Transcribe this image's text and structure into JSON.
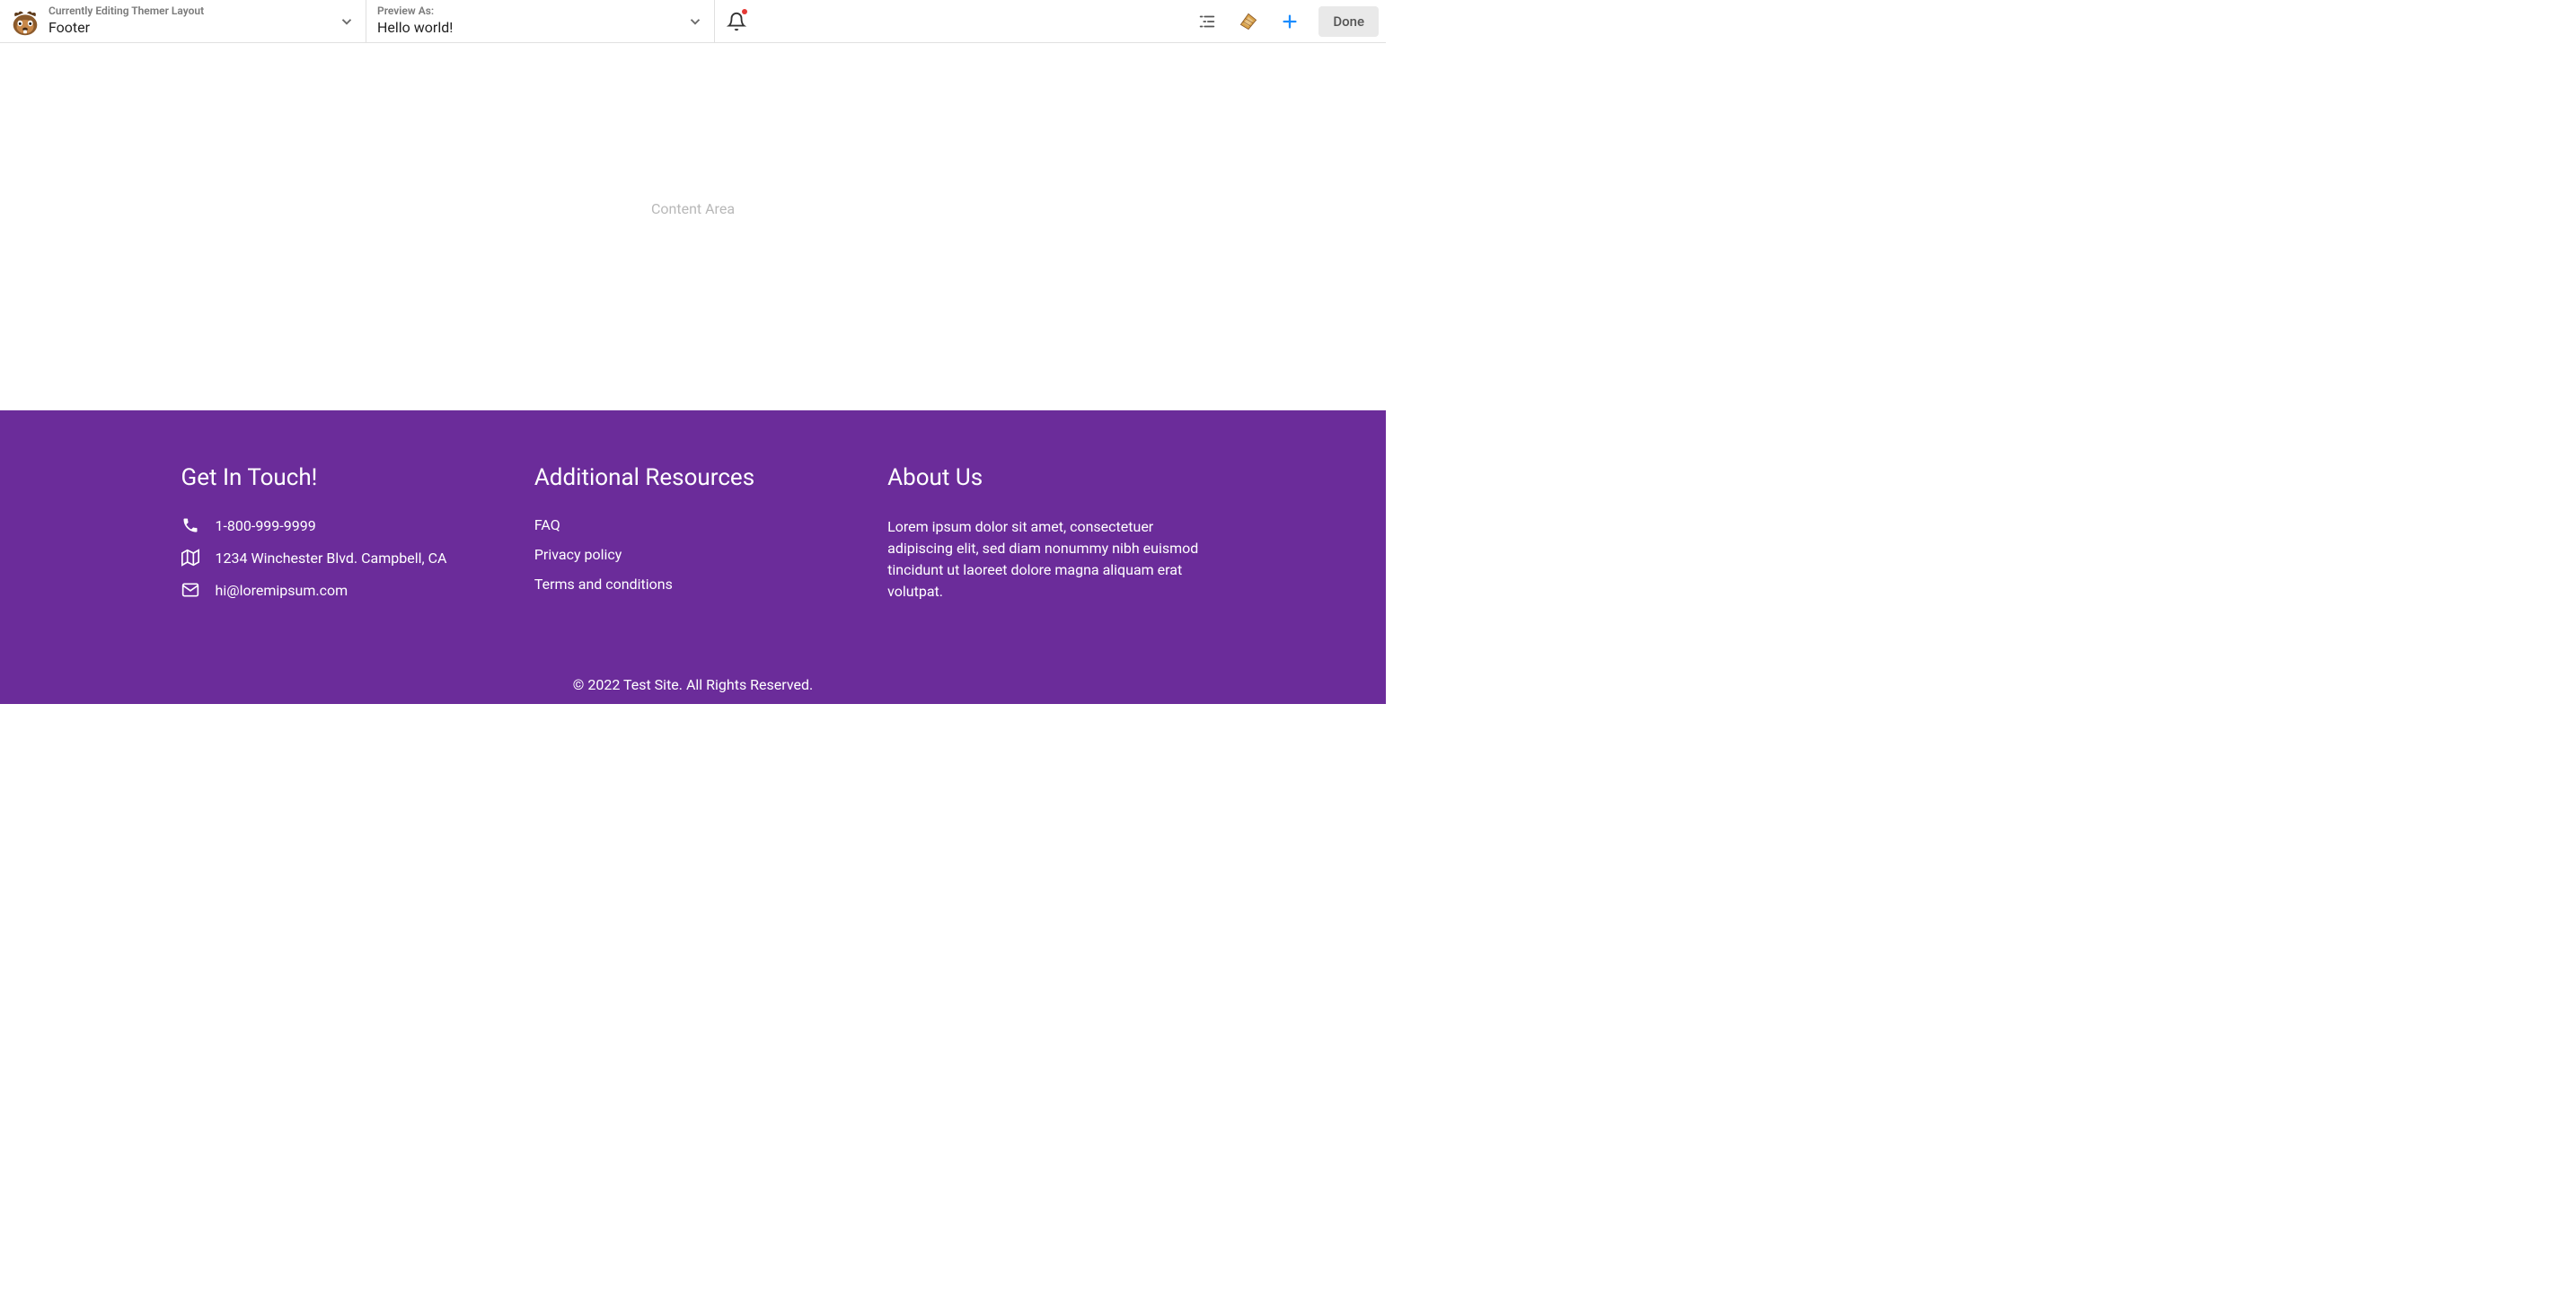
{
  "topbar": {
    "editing": {
      "sublabel": "Currently Editing Themer Layout",
      "title": "Footer"
    },
    "preview": {
      "sublabel": "Preview As:",
      "title": "Hello world!"
    },
    "done_label": "Done"
  },
  "content": {
    "placeholder": "Content Area"
  },
  "footer": {
    "col1": {
      "heading": "Get In Touch!",
      "phone": "1-800-999-9999",
      "address": "1234 Winchester Blvd. Campbell, CA",
      "email": "hi@loremipsum.com"
    },
    "col2": {
      "heading": "Additional Resources",
      "links": {
        "0": "FAQ",
        "1": "Privacy policy",
        "2": "Terms and conditions"
      }
    },
    "col3": {
      "heading": "About Us",
      "text": "Lorem ipsum dolor sit amet, consectetuer adipiscing elit, sed diam nonummy nibh euismod tincidunt ut laoreet dolore magna aliquam erat volutpat."
    },
    "copyright": "© 2022 Test Site. All Rights Reserved."
  }
}
